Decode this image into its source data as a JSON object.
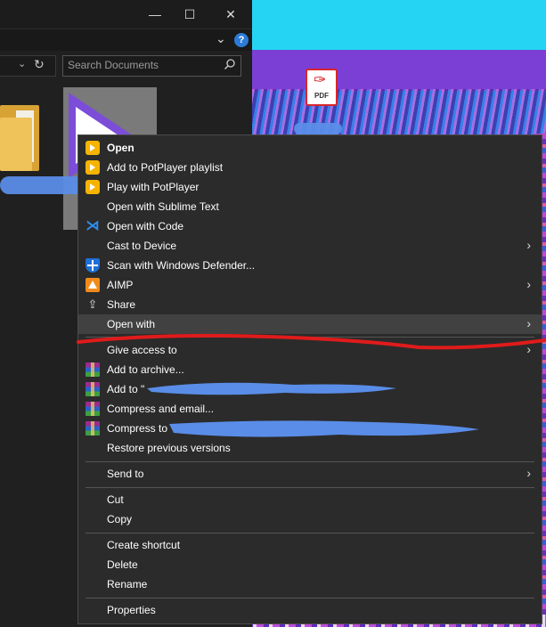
{
  "desktop": {
    "pdf_icon_label": "PDF"
  },
  "explorer": {
    "search_placeholder": "Search Documents",
    "window_controls": {
      "minimize": "—",
      "maximize": "☐",
      "close": "✕"
    },
    "help_label": "?"
  },
  "context_menu": {
    "items": [
      {
        "label": "Open",
        "icon": "potplayer-icon"
      },
      {
        "label": "Add to PotPlayer playlist",
        "icon": "potplayer-icon"
      },
      {
        "label": "Play with PotPlayer",
        "icon": "potplayer-icon"
      },
      {
        "label": "Open with Sublime Text",
        "icon": ""
      },
      {
        "label": "Open with Code",
        "icon": "vscode-icon"
      },
      {
        "label": "Cast to Device",
        "icon": "",
        "submenu": true
      },
      {
        "label": "Scan with Windows Defender...",
        "icon": "defender-icon"
      },
      {
        "label": "AIMP",
        "icon": "aimp-icon",
        "submenu": true
      },
      {
        "label": "Share",
        "icon": "share-icon"
      },
      {
        "label": "Open with",
        "icon": "",
        "submenu": true,
        "highlighted": true
      },
      {
        "label": "Give access to",
        "icon": "",
        "submenu": true
      },
      {
        "label": "Add to archive...",
        "icon": "winrar-icon"
      },
      {
        "label": "Add to \"",
        "icon": "winrar-icon"
      },
      {
        "label": "Compress and email...",
        "icon": "winrar-icon"
      },
      {
        "label": "Compress to",
        "icon": "winrar-icon"
      },
      {
        "label": "Restore previous versions",
        "icon": ""
      },
      {
        "label": "Send to",
        "icon": "",
        "submenu": true
      },
      {
        "label": "Cut",
        "icon": ""
      },
      {
        "label": "Copy",
        "icon": ""
      },
      {
        "label": "Create shortcut",
        "icon": ""
      },
      {
        "label": "Delete",
        "icon": ""
      },
      {
        "label": "Rename",
        "icon": ""
      },
      {
        "label": "Properties",
        "icon": ""
      }
    ],
    "submenu_arrow": "›"
  },
  "colors": {
    "menu_bg": "#2b2b2b",
    "menu_hover": "#414141",
    "annotation_red": "#e01b1b",
    "redaction_blue": "#5a8de8"
  }
}
